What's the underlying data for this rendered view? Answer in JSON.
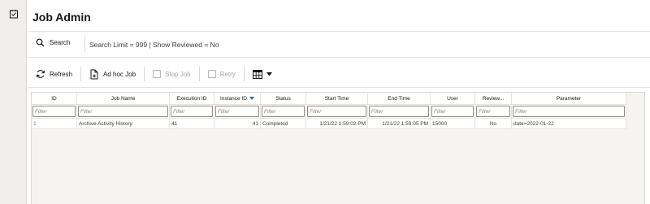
{
  "app": {
    "title": "Job Admin"
  },
  "search": {
    "label": "Search",
    "info": "Search Limit = 999 | Show Reviewed = No"
  },
  "toolbar": {
    "refresh": "Refresh",
    "adhoc": "Ad hoc Job",
    "stop": "Stop Job",
    "retry": "Retry"
  },
  "table": {
    "columns": [
      "ID",
      "Job Name",
      "Execution ID",
      "Instance ID",
      "Status",
      "Start Time",
      "End Time",
      "User",
      "Review...",
      "Parameter"
    ],
    "filter_placeholder": "Filter",
    "rows": [
      [
        "1",
        "Archive Activity History",
        "41",
        "41",
        "Completed",
        "1/21/22 1:59:02 PM",
        "1/21/22 1:59:05 PM",
        "15000",
        "No",
        "date=2022-01-22"
      ]
    ]
  },
  "colors": {
    "accent": "#227093",
    "rail": "#f1efed",
    "grid_bg": "#f5f4f2"
  },
  "icons": {
    "rail": "checklist-icon",
    "search": "search-icon",
    "refresh": "refresh-icon",
    "adhoc": "new-job-icon",
    "columns": "table-columns-icon",
    "dropdown": "caret-down-icon"
  }
}
